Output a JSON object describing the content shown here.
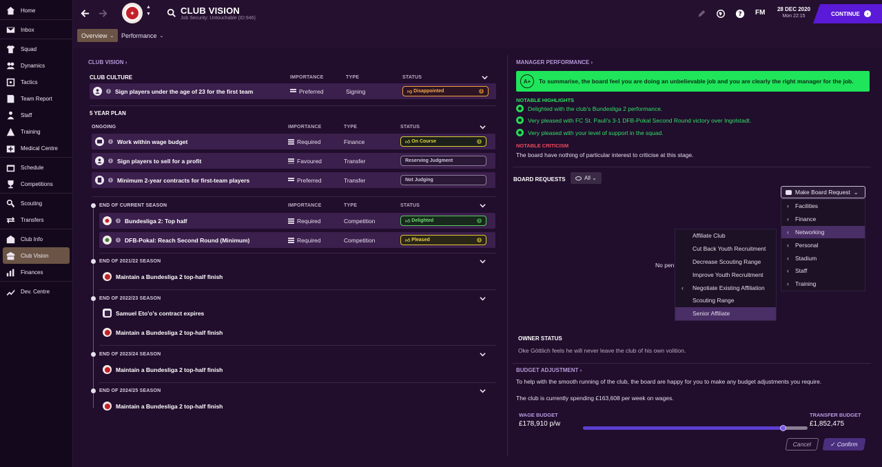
{
  "sidebar": {
    "items": [
      {
        "label": "Home",
        "icon": "home-icon"
      },
      {
        "label": "Inbox",
        "icon": "inbox-icon"
      },
      {
        "label": "Squad",
        "icon": "shirt-icon"
      },
      {
        "label": "Dynamics",
        "icon": "dynamics-icon"
      },
      {
        "label": "Tactics",
        "icon": "tactics-icon"
      },
      {
        "label": "Team Report",
        "icon": "report-icon"
      },
      {
        "label": "Staff",
        "icon": "staff-icon"
      },
      {
        "label": "Training",
        "icon": "training-icon"
      },
      {
        "label": "Medical Centre",
        "icon": "medical-icon"
      },
      {
        "label": "Schedule",
        "icon": "calendar-icon"
      },
      {
        "label": "Competitions",
        "icon": "trophy-icon"
      },
      {
        "label": "Scouting",
        "icon": "search-icon"
      },
      {
        "label": "Transfers",
        "icon": "transfer-icon"
      },
      {
        "label": "Club Info",
        "icon": "club-info-icon"
      },
      {
        "label": "Club Vision",
        "icon": "club-vision-icon"
      },
      {
        "label": "Finances",
        "icon": "finances-icon"
      },
      {
        "label": "Dev. Centre",
        "icon": "dev-centre-icon"
      }
    ]
  },
  "header": {
    "title": "CLUB VISION",
    "subtitle": "Job Security: Untouchable (ID:946)",
    "tabs": [
      {
        "label": "Overview"
      },
      {
        "label": "Performance"
      }
    ],
    "fm_logo": "FM",
    "date": "28 DEC 2020",
    "time": "Mon 22:15",
    "continue_label": "CONTINUE"
  },
  "left": {
    "club_vision_link": "CLUB VISION",
    "club_culture_head": "CLUB CULTURE",
    "five_year_plan": "5 YEAR PLAN",
    "ongoing": "ONGOING",
    "col_importance": "IMPORTANCE",
    "col_type": "TYPE",
    "col_status": "STATUS",
    "culture_rows": [
      {
        "text": "Sign players under the age of 23 for the first team",
        "importance": "Preferred",
        "type": "Signing",
        "status": "Disappointed"
      }
    ],
    "ongoing_rows": [
      {
        "text": "Work within wage budget",
        "importance": "Required",
        "type": "Finance",
        "status": "On Course"
      },
      {
        "text": "Sign players to sell for a profit",
        "importance": "Favoured",
        "type": "Transfer",
        "status": "Reserving Judgment"
      },
      {
        "text": "Minimum 2-year contracts for first-team players",
        "importance": "Preferred",
        "type": "Transfer",
        "status": "Not Judging"
      }
    ],
    "end_current_season": "END OF CURRENT SEASON",
    "current_rows": [
      {
        "text": "Bundesliga 2: Top half",
        "importance": "Required",
        "type": "Competition",
        "status": "Delighted"
      },
      {
        "text": "DFB-Pokal: Reach Second Round (Minimum)",
        "importance": "Required",
        "type": "Competition",
        "status": "Pleased"
      }
    ],
    "seasons": [
      {
        "head": "END OF 2021/22 SEASON",
        "items": [
          "Maintain a Bundesliga 2 top-half finish"
        ]
      },
      {
        "head": "END OF 2022/23 SEASON",
        "items": [
          "Samuel Eto'o's contract expires",
          "Maintain a Bundesliga 2 top-half finish"
        ]
      },
      {
        "head": "END OF 2023/24 SEASON",
        "items": [
          "Maintain a Bundesliga 2 top-half finish"
        ]
      },
      {
        "head": "END OF 2024/25 SEASON",
        "items": [
          "Maintain a Bundesliga 2 top-half finish"
        ]
      }
    ]
  },
  "right": {
    "manager_performance": "MANAGER PERFORMANCE",
    "grade": "A+",
    "summary": "To summarise, the board feel you are doing an unbelievable job and you are clearly the right manager for the job.",
    "notable_highlights": "NOTABLE HIGHLIGHTS",
    "highlights": [
      "Delighted with the club's Bundesliga 2 performance.",
      "Very pleased with FC St. Pauli's 3-1 DFB-Pokal Second Round victory over Ingolstadt.",
      "Very pleased with your level of support in the squad."
    ],
    "notable_criticism": "NOTABLE CRITICISM",
    "criticism": "The board have nothing of particular interest to criticise at this stage.",
    "board_requests": "BOARD REQUESTS",
    "filter": "All",
    "make_request": "Make Board Request",
    "request_categories": [
      "Facilities",
      "Finance",
      "Networking",
      "Personal",
      "Stadium",
      "Staff",
      "Training"
    ],
    "networking_options": [
      "Affiliate Club",
      "Cut Back Youth Recruitment",
      "Decrease Scouting Range",
      "Improve Youth Recruitment",
      "Negotiate Existing Affiliation",
      "Scouting Range",
      "Senior Affiliate"
    ],
    "no_pending": "No pen",
    "owner_status": "OWNER STATUS",
    "owner_text": "Oke Göttlich feels he will never leave the club of his own volition.",
    "budget_adjustment": "BUDGET ADJUSTMENT",
    "budget_text1": "To help with the smooth running of the club, the board are happy for you to make any budget adjustments you require.",
    "budget_text2": "The club is currently spending £163,608 per week on wages.",
    "wage_budget_label": "WAGE BUDGET",
    "wage_budget": "£178,910 p/w",
    "transfer_budget_label": "TRANSFER BUDGET",
    "transfer_budget": "£1,852,475",
    "slider_fraction": 0.89,
    "cancel": "Cancel",
    "confirm": "Confirm"
  }
}
